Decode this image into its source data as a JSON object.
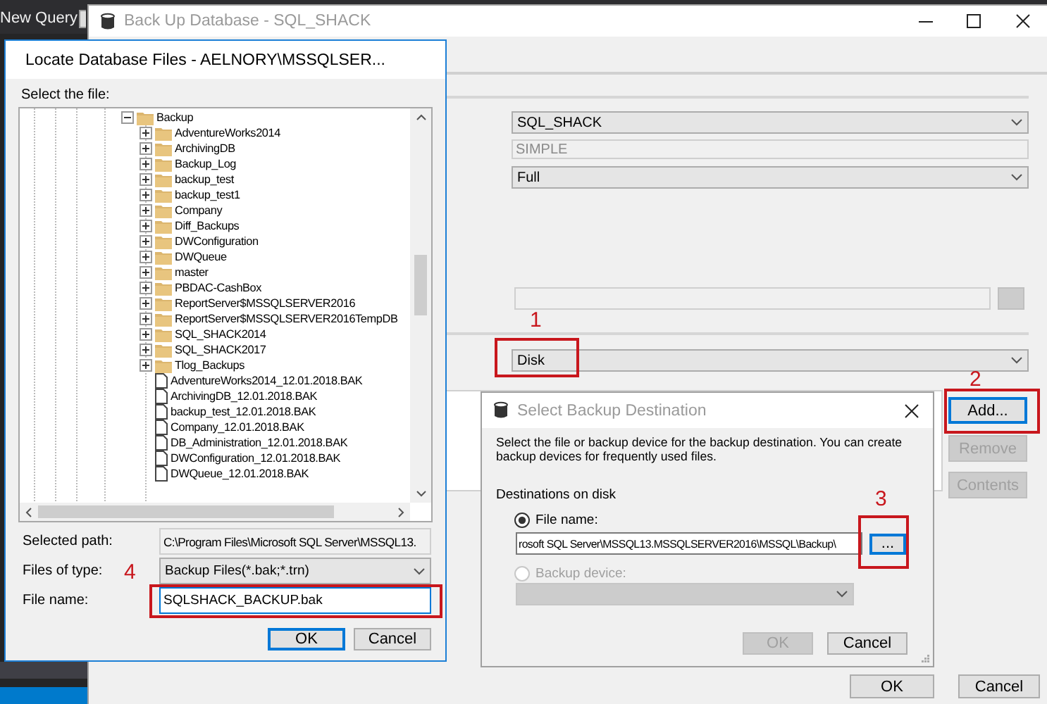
{
  "ssms_toolbar": {
    "new_query": "New Query"
  },
  "backup_window": {
    "title": "Back Up Database - SQL_SHACK",
    "active": false,
    "database": "SQL_SHACK",
    "recovery_model": "SIMPLE",
    "backup_type": "Full",
    "backup_to": "Disk",
    "side_buttons": [
      {
        "label": "Add...",
        "disabled": false,
        "focused": true
      },
      {
        "label": "Remove",
        "disabled": true,
        "focused": false
      },
      {
        "label": "Contents",
        "disabled": true,
        "focused": false
      }
    ],
    "footer_buttons": [
      {
        "label": "OK"
      },
      {
        "label": "Cancel"
      }
    ]
  },
  "locate_dialog": {
    "title": "Locate Database Files - AELNORY\\MSSQLSER...",
    "active": true,
    "prompt": "Select the file:",
    "tree": [
      {
        "label": "Backup",
        "kind": "folder",
        "expanded": true,
        "children": [
          {
            "label": "AdventureWorks2014",
            "kind": "folder",
            "expanded": false
          },
          {
            "label": "ArchivingDB",
            "kind": "folder",
            "expanded": false
          },
          {
            "label": "Backup_Log",
            "kind": "folder",
            "expanded": false
          },
          {
            "label": "backup_test",
            "kind": "folder",
            "expanded": false
          },
          {
            "label": "backup_test1",
            "kind": "folder",
            "expanded": false
          },
          {
            "label": "Company",
            "kind": "folder",
            "expanded": false
          },
          {
            "label": "Diff_Backups",
            "kind": "folder",
            "expanded": false
          },
          {
            "label": "DWConfiguration",
            "kind": "folder",
            "expanded": false
          },
          {
            "label": "DWQueue",
            "kind": "folder",
            "expanded": false
          },
          {
            "label": "master",
            "kind": "folder",
            "expanded": false
          },
          {
            "label": "PBDAC-CashBox",
            "kind": "folder",
            "expanded": false
          },
          {
            "label": "ReportServer$MSSQLSERVER2016",
            "kind": "folder",
            "expanded": false
          },
          {
            "label": "ReportServer$MSSQLSERVER2016TempDB",
            "kind": "folder",
            "expanded": false
          },
          {
            "label": "SQL_SHACK2014",
            "kind": "folder",
            "expanded": false
          },
          {
            "label": "SQL_SHACK2017",
            "kind": "folder",
            "expanded": false
          },
          {
            "label": "Tlog_Backups",
            "kind": "folder",
            "expanded": false
          },
          {
            "label": "AdventureWorks2014_12.01.2018.BAK",
            "kind": "file"
          },
          {
            "label": "ArchivingDB_12.01.2018.BAK",
            "kind": "file"
          },
          {
            "label": "backup_test_12.01.2018.BAK",
            "kind": "file"
          },
          {
            "label": "Company_12.01.2018.BAK",
            "kind": "file"
          },
          {
            "label": "DB_Administration_12.01.2018.BAK",
            "kind": "file"
          },
          {
            "label": "DWConfiguration_12.01.2018.BAK",
            "kind": "file"
          },
          {
            "label": "DWQueue_12.01.2018.BAK",
            "kind": "file"
          }
        ]
      }
    ],
    "selected_path_label": "Selected path:",
    "selected_path": "C:\\Program Files\\Microsoft SQL Server\\MSSQL13.",
    "file_type_label": "Files of type:",
    "file_type": "Backup Files(*.bak;*.trn)",
    "file_name_label": "File name:",
    "file_name": "SQLSHACK_BACKUP.bak",
    "buttons": [
      {
        "label": "OK",
        "focused": true
      },
      {
        "label": "Cancel",
        "focused": false
      }
    ]
  },
  "destination_dialog": {
    "title": "Select Backup Destination",
    "active": false,
    "description": "Select the file or backup device for the backup destination. You can create backup devices for frequently used files.",
    "section": "Destinations on disk",
    "options": [
      {
        "label": "File name:",
        "kind": "field",
        "selected": true,
        "disabled": false,
        "value": "rosoft SQL Server\\MSSQL13.MSSQLSERVER2016\\MSSQL\\Backup\\"
      },
      {
        "label": "Backup device:",
        "kind": "dropdown",
        "selected": false,
        "disabled": true
      }
    ],
    "browse_button": {
      "label": "...",
      "focused": true
    },
    "buttons": [
      {
        "label": "OK",
        "disabled": true
      },
      {
        "label": "Cancel",
        "disabled": false
      }
    ]
  },
  "annotations": [
    {
      "label": "1"
    },
    {
      "label": "2"
    },
    {
      "label": "3"
    },
    {
      "label": "4"
    }
  ]
}
